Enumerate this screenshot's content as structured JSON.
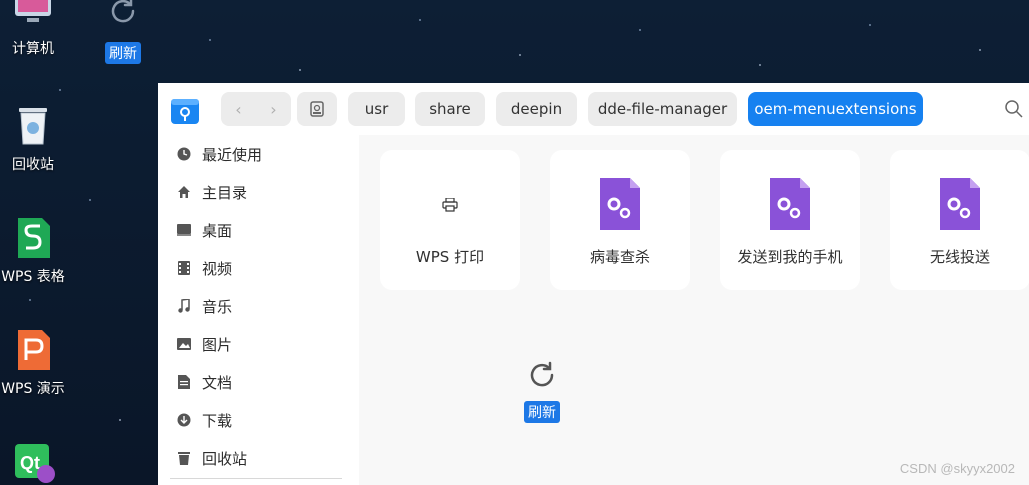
{
  "desktop": {
    "icons": [
      {
        "label": "计算机"
      },
      {
        "label": "回收站"
      },
      {
        "label": "WPS 表格"
      },
      {
        "label": "WPS 演示"
      },
      {
        "label": ""
      }
    ],
    "refresh_label": "刷新"
  },
  "file_manager": {
    "breadcrumbs": [
      "usr",
      "share",
      "deepin",
      "dde-file-manager",
      "oem-menuextensions"
    ],
    "active_breadcrumb": "oem-menuextensions",
    "sidebar": {
      "items": [
        {
          "label": "最近使用",
          "icon": "clock-icon"
        },
        {
          "label": "主目录",
          "icon": "home-icon"
        },
        {
          "label": "桌面",
          "icon": "desktop-icon"
        },
        {
          "label": "视频",
          "icon": "video-icon"
        },
        {
          "label": "音乐",
          "icon": "music-icon"
        },
        {
          "label": "图片",
          "icon": "picture-icon"
        },
        {
          "label": "文档",
          "icon": "document-icon"
        },
        {
          "label": "下载",
          "icon": "download-icon"
        },
        {
          "label": "回收站",
          "icon": "trash-icon"
        }
      ]
    },
    "files": [
      {
        "name": "WPS 打印",
        "icon": "printer-icon"
      },
      {
        "name": "病毒查杀",
        "icon": "config-file-icon"
      },
      {
        "name": "发送到我的手机",
        "icon": "config-file-icon"
      },
      {
        "name": "无线投送",
        "icon": "config-file-icon"
      }
    ],
    "context_refresh_label": "刷新"
  },
  "watermark": "CSDN @skyyx2002",
  "colors": {
    "accent": "#1681f0",
    "file_icon_purple": "#8a52d8",
    "desktop_bg": "#0b1a2e"
  }
}
